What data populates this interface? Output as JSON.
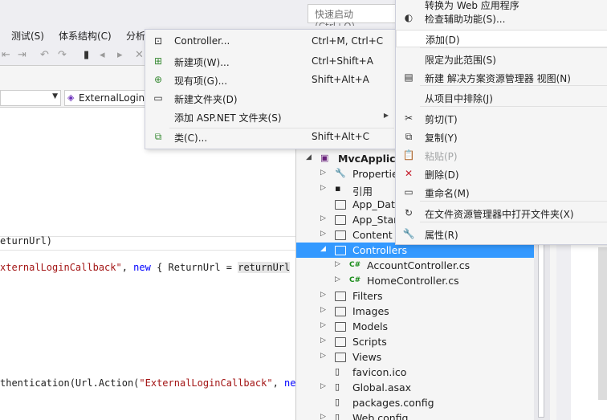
{
  "quick_launch": {
    "placeholder": "快速启动 (Ctrl+Q)"
  },
  "menubar": {
    "items": [
      "测试(S)",
      "体系结构(C)",
      "分析"
    ]
  },
  "navbar": {
    "member": "ExternalLogin("
  },
  "code_lines": [
    {
      "parts": [
        [
          "",
          "eturnUrl)"
        ]
      ]
    },
    {
      "parts": [
        [
          "st",
          "xternalLoginCallback\""
        ],
        [
          "",
          ", "
        ],
        [
          "kw",
          "new"
        ],
        [
          "",
          " { ReturnUrl = "
        ],
        [
          "hl",
          "returnUrl"
        ],
        [
          "",
          " })"
        ]
      ]
    },
    {
      "parts": [
        [
          "",
          "thentication(Url.Action("
        ],
        [
          "st",
          "\"ExternalLoginCallback\""
        ],
        [
          "",
          ", "
        ],
        [
          "kw",
          "new"
        ]
      ]
    }
  ],
  "add_submenu": {
    "items": [
      {
        "label": "Controller...",
        "shortcut": "Ctrl+M, Ctrl+C",
        "icon": "controller-icon"
      },
      {
        "label": "新建项(W)...",
        "shortcut": "Ctrl+Shift+A",
        "icon": "new-item-icon"
      },
      {
        "label": "现有项(G)...",
        "shortcut": "Shift+Alt+A",
        "icon": "existing-item-icon"
      },
      {
        "label": "新建文件夹(D)",
        "shortcut": "",
        "icon": "new-folder-icon"
      },
      {
        "label": "添加 ASP.NET 文件夹(S)",
        "shortcut": "",
        "icon": "",
        "submenu": true
      },
      {
        "label": "类(C)...",
        "shortcut": "Shift+Alt+C",
        "icon": "class-icon"
      }
    ]
  },
  "context_menu": {
    "items": [
      {
        "label": "转换为 Web 应用程序",
        "icon": "",
        "disabled": false
      },
      {
        "label": "检查辅助功能(S)...",
        "icon": "accessibility-icon",
        "disabled": false
      },
      {
        "label": "添加(D)",
        "icon": "",
        "disabled": false,
        "highlighted": true
      },
      {
        "label": "限定为此范围(S)",
        "icon": "",
        "disabled": false
      },
      {
        "label": "新建 解决方案资源管理器 视图(N)",
        "icon": "new-view-icon",
        "disabled": false
      },
      {
        "label": "从项目中排除(J)",
        "icon": "",
        "disabled": false
      },
      {
        "label": "剪切(T)",
        "icon": "cut-icon",
        "disabled": false
      },
      {
        "label": "复制(Y)",
        "icon": "copy-icon",
        "disabled": false
      },
      {
        "label": "粘贴(P)",
        "icon": "paste-icon",
        "disabled": true
      },
      {
        "label": "删除(D)",
        "icon": "delete-icon",
        "disabled": false
      },
      {
        "label": "重命名(M)",
        "icon": "rename-icon",
        "disabled": false
      },
      {
        "label": "在文件资源管理器中打开文件夹(X)",
        "icon": "open-folder-icon",
        "disabled": false
      },
      {
        "label": "属性(R)",
        "icon": "properties-icon",
        "disabled": false
      }
    ]
  },
  "solution_tree": [
    {
      "label": "MvcApplica",
      "depth": 0,
      "arrow": "open",
      "icon": "project-icon"
    },
    {
      "label": "Properties",
      "depth": 1,
      "arrow": "closed",
      "icon": "wrench-icon"
    },
    {
      "label": "引用",
      "depth": 1,
      "arrow": "closed",
      "icon": "references-icon"
    },
    {
      "label": "App_Data",
      "depth": 1,
      "arrow": "",
      "icon": "folder-icon"
    },
    {
      "label": "App_Start",
      "depth": 1,
      "arrow": "closed",
      "icon": "folder-icon"
    },
    {
      "label": "Content",
      "depth": 1,
      "arrow": "closed",
      "icon": "folder-icon"
    },
    {
      "label": "Controllers",
      "depth": 1,
      "arrow": "open",
      "icon": "folder-icon",
      "selected": true
    },
    {
      "label": "AccountController.cs",
      "depth": 2,
      "arrow": "closed",
      "icon": "csharp-icon"
    },
    {
      "label": "HomeController.cs",
      "depth": 2,
      "arrow": "closed",
      "icon": "csharp-icon"
    },
    {
      "label": "Filters",
      "depth": 1,
      "arrow": "closed",
      "icon": "folder-icon"
    },
    {
      "label": "Images",
      "depth": 1,
      "arrow": "closed",
      "icon": "folder-icon"
    },
    {
      "label": "Models",
      "depth": 1,
      "arrow": "closed",
      "icon": "folder-icon"
    },
    {
      "label": "Scripts",
      "depth": 1,
      "arrow": "closed",
      "icon": "folder-icon"
    },
    {
      "label": "Views",
      "depth": 1,
      "arrow": "closed",
      "icon": "folder-icon"
    },
    {
      "label": "favicon.ico",
      "depth": 1,
      "arrow": "",
      "icon": "image-file-icon"
    },
    {
      "label": "Global.asax",
      "depth": 1,
      "arrow": "closed",
      "icon": "file-icon"
    },
    {
      "label": "packages.config",
      "depth": 1,
      "arrow": "",
      "icon": "config-file-icon"
    },
    {
      "label": "Web.config",
      "depth": 1,
      "arrow": "closed",
      "icon": "config-file-icon"
    }
  ],
  "colors": {
    "selection": "#3399ff",
    "menu_bg": "#f5f5f5",
    "string": "#a31515",
    "keyword": "#0000ff"
  }
}
